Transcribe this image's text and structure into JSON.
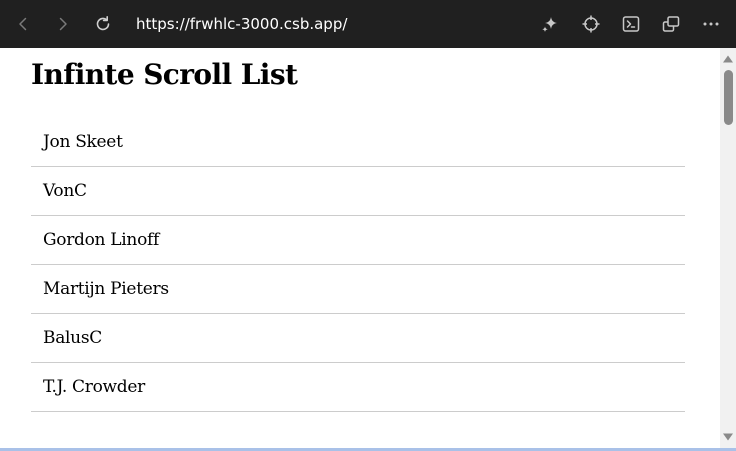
{
  "browser": {
    "url": "https://frwhlc-3000.csb.app/",
    "icons": {
      "back": "arrow-left-icon",
      "forward": "arrow-right-icon",
      "refresh": "refresh-icon",
      "copilot": "sparkle-icon",
      "inspect": "crosshair-icon",
      "terminal": "terminal-icon",
      "new_window": "open-in-new-window-icon",
      "more": "more-horizontal-icon"
    },
    "colors": {
      "toolbar_bg": "#202020",
      "icon": "#c8c8c8",
      "url_text": "#ffffff"
    }
  },
  "page": {
    "title": "Infinte Scroll List",
    "items": [
      "Jon Skeet",
      "VonC",
      "Gordon Linoff",
      "Martijn Pieters",
      "BalusC",
      "T.J. Crowder"
    ]
  }
}
